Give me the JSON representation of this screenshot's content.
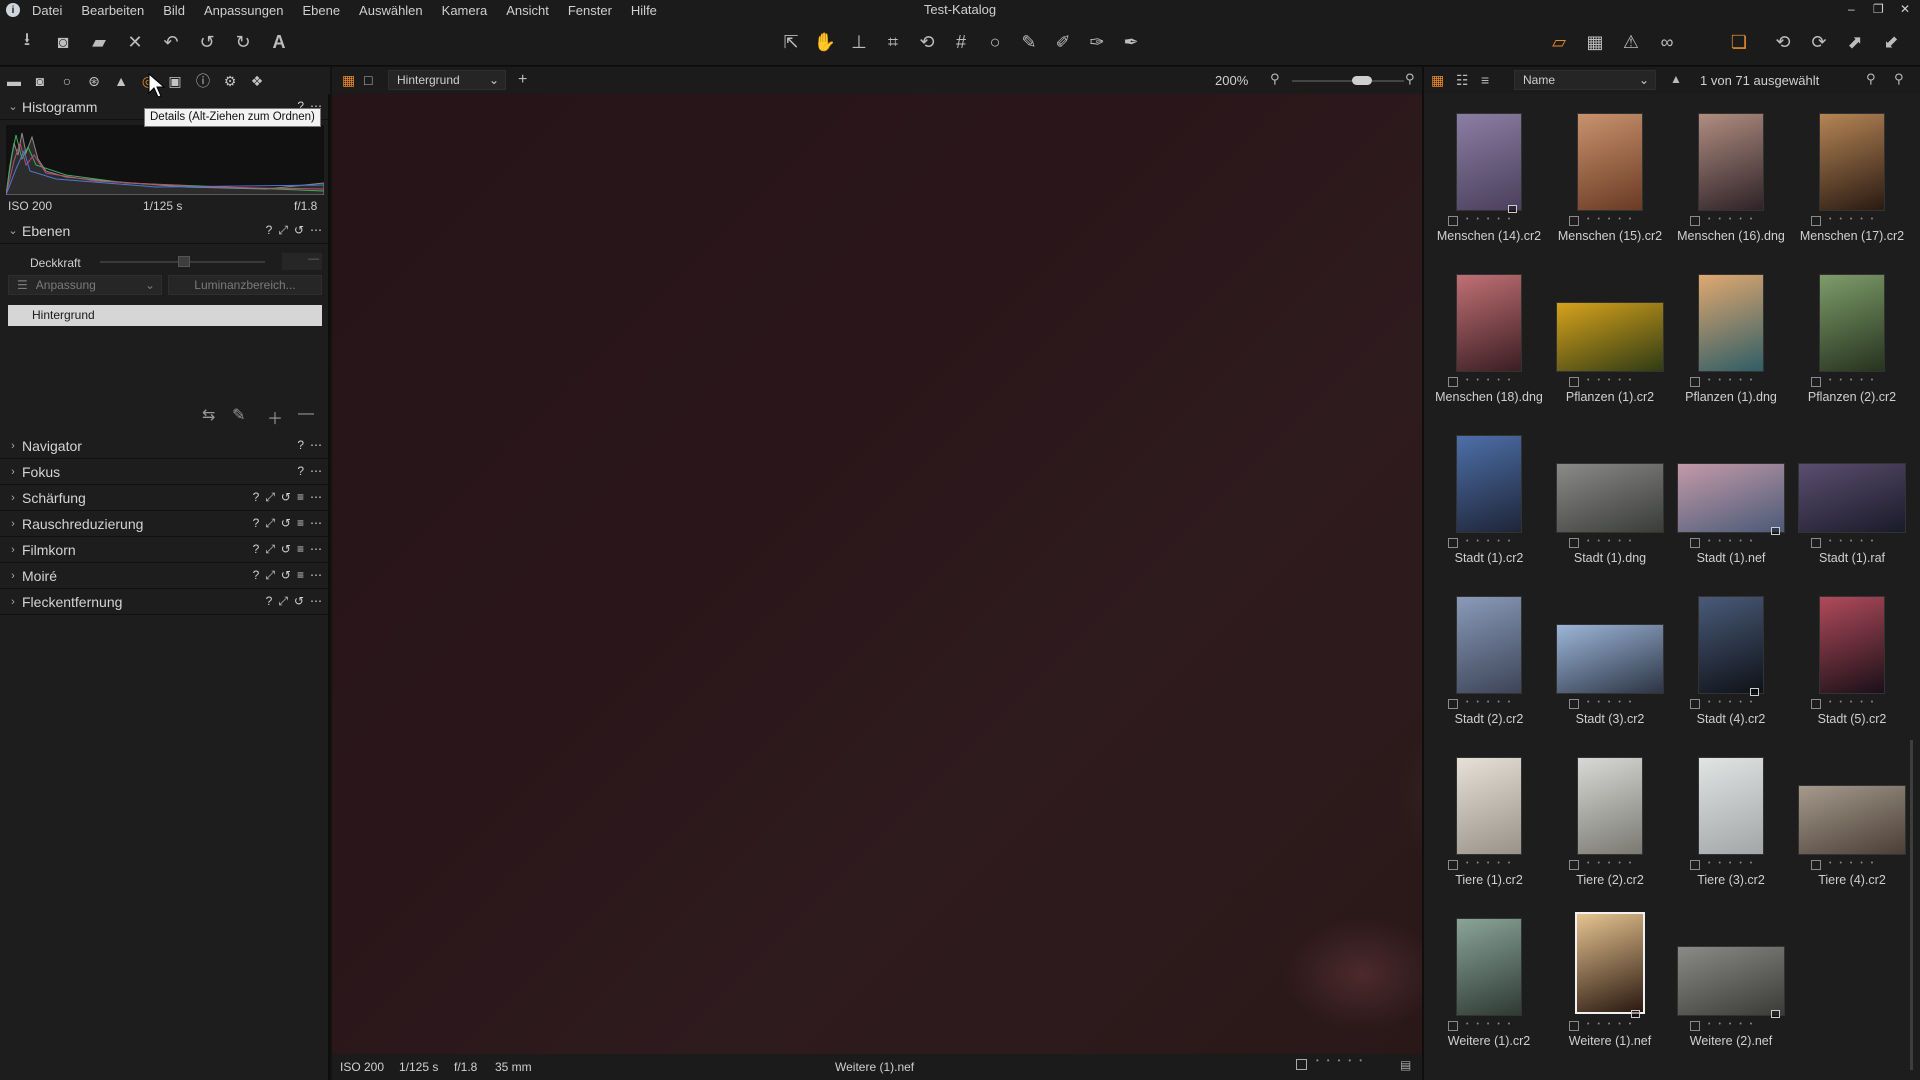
{
  "app": {
    "window_title": "Test-Katalog"
  },
  "menubar": {
    "items": [
      "Datei",
      "Bearbeiten",
      "Bild",
      "Anpassungen",
      "Ebene",
      "Auswählen",
      "Kamera",
      "Ansicht",
      "Fenster",
      "Hilfe"
    ]
  },
  "toolbar": {
    "left_icons": [
      "import-icon",
      "camera-icon",
      "folder-icon",
      "delete-icon",
      "undo-icon",
      "undo-icon",
      "redo-icon",
      "text-icon"
    ],
    "center_icons": [
      "select-icon",
      "hand-icon",
      "stamp-icon",
      "crop-icon",
      "rotate-icon",
      "keystone-icon",
      "circle-icon",
      "picker-icon",
      "brush-icon",
      "eraser-icon",
      "pen-icon"
    ]
  },
  "tooltabs": {
    "icons": [
      "library-icon",
      "capture-icon",
      "color-icon",
      "color-balance-icon",
      "exposure-icon",
      "details-icon",
      "metadata-icon",
      "info-icon",
      "settings-icon",
      "batch-icon"
    ],
    "tooltip": "Details (Alt-Ziehen zum Ordnen)"
  },
  "histogram": {
    "title": "Histogramm",
    "iso": "ISO 200",
    "shutter": "1/125 s",
    "aperture": "f/1.8"
  },
  "layers": {
    "title": "Ebenen",
    "opacity_label": "Deckkraft",
    "adjust_label": "Anpassung",
    "luminance_label": "Luminanzbereich...",
    "layer_name": "Hintergrund"
  },
  "sections": [
    "Navigator",
    "Fokus",
    "Schärfung",
    "Rauschreduzierung",
    "Filmkorn",
    "Moiré",
    "Fleckentfernung"
  ],
  "viewer": {
    "layer_select": "Hintergrund",
    "zoom": "200%",
    "footer": {
      "iso": "ISO 200",
      "shutter": "1/125 s",
      "aperture": "f/1.8",
      "focal": "35 mm",
      "filename": "Weitere (1).nef"
    }
  },
  "browser": {
    "sort": "Name",
    "count": "1 von 71 ausgewählt",
    "thumbs": [
      {
        "label": "Menschen (14).cr2",
        "colors": [
          "#8b7ea3",
          "#4a3f5c"
        ]
      },
      {
        "label": "Menschen (15).cr2",
        "colors": [
          "#c8926c",
          "#6a3a24"
        ]
      },
      {
        "label": "Menschen (16).dng",
        "colors": [
          "#b08d80",
          "#2e2228"
        ]
      },
      {
        "label": "Menschen (17).cr2",
        "colors": [
          "#b58555",
          "#2a1a12"
        ]
      },
      {
        "label": "Menschen (18).dng",
        "colors": [
          "#c07075",
          "#3a1e22"
        ]
      },
      {
        "label": "Pflanzen (1).cr2",
        "colors": [
          "#d6a21c",
          "#2f3b14"
        ]
      },
      {
        "label": "Pflanzen (1).dng",
        "colors": [
          "#e0a870",
          "#2f5d66"
        ]
      },
      {
        "label": "Pflanzen (2).cr2",
        "colors": [
          "#7e9c6a",
          "#26331e"
        ]
      },
      {
        "label": "Stadt (1).cr2",
        "colors": [
          "#4d6fa8",
          "#1e2538"
        ]
      },
      {
        "label": "Stadt (1).dng",
        "colors": [
          "#8a8a88",
          "#3a3c3a"
        ]
      },
      {
        "label": "Stadt (1).nef",
        "colors": [
          "#c39aa8",
          "#4a5a78"
        ]
      },
      {
        "label": "Stadt (1).raf",
        "colors": [
          "#5a4e70",
          "#1a1a28"
        ]
      },
      {
        "label": "Stadt (2).cr2",
        "colors": [
          "#8a9ab8",
          "#3c4458"
        ]
      },
      {
        "label": "Stadt (3).cr2",
        "colors": [
          "#9cb6d8",
          "#2c3444"
        ]
      },
      {
        "label": "Stadt (4).cr2",
        "colors": [
          "#4a5a78",
          "#0e1218"
        ]
      },
      {
        "label": "Stadt (5).cr2",
        "colors": [
          "#b04a5a",
          "#1a1018"
        ]
      },
      {
        "label": "Tiere (1).cr2",
        "colors": [
          "#e6e0d6",
          "#9a9288"
        ]
      },
      {
        "label": "Tiere (2).cr2",
        "colors": [
          "#d8d8d6",
          "#7a7a72"
        ]
      },
      {
        "label": "Tiere (3).cr2",
        "colors": [
          "#e2e4e4",
          "#a2a6a6"
        ]
      },
      {
        "label": "Tiere (4).cr2",
        "colors": [
          "#a59a8c",
          "#4a3e36"
        ]
      },
      {
        "label": "Weitere (1).cr2",
        "colors": [
          "#8aa49a",
          "#2e3a34"
        ]
      },
      {
        "label": "Weitere (1).nef",
        "colors": [
          "#e6c490",
          "#2a1810"
        ]
      },
      {
        "label": "Weitere (2).nef",
        "colors": [
          "#8a8a86",
          "#3a3a38"
        ]
      }
    ]
  }
}
